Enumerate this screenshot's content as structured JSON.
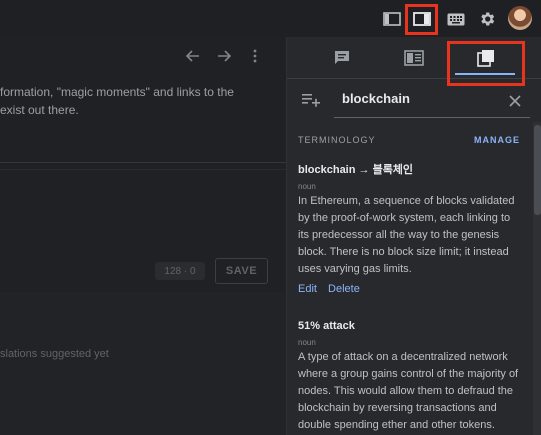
{
  "topbar": {
    "icons": [
      "sidebar-left-icon",
      "sidebar-right-icon",
      "keyboard-icon",
      "gear-icon"
    ],
    "highlight_color": "#e8331f"
  },
  "editor": {
    "nav_icons": [
      "arrow-left-icon",
      "arrow-right-icon",
      "more-vert-icon"
    ],
    "source_text_line1": "formation, \"magic moments\" and links to the",
    "source_text_line2": " exist out there.",
    "counter": "128 · 0",
    "save_label": "SAVE",
    "suggestions_text": "slations suggested yet"
  },
  "panel": {
    "tabs": [
      "comment-icon",
      "details-icon",
      "terminology-icon"
    ],
    "active_tab": 2,
    "search": {
      "value": "blockchain",
      "icon": "add-term-icon"
    },
    "section_title": "TERMINOLOGY",
    "manage_label": "MANAGE",
    "entries": [
      {
        "term": "blockchain → 블록체인",
        "pos": "noun",
        "definition": "In Ethereum, a sequence of blocks validated by the proof-of-work system, each linking to its predecessor all the way to the genesis block. There is no block size limit; it instead uses varying gas limits.",
        "actions": [
          "Edit",
          "Delete"
        ]
      },
      {
        "term": "51% attack",
        "pos": "noun",
        "definition": "A type of attack on a decentralized network where a group gains control of the majority of nodes. This would allow them to defraud the blockchain by reversing transactions and double spending ether and other tokens."
      }
    ]
  },
  "colors": {
    "accent": "#8ab4f8",
    "background": "#202124",
    "panel": "#28292c"
  }
}
